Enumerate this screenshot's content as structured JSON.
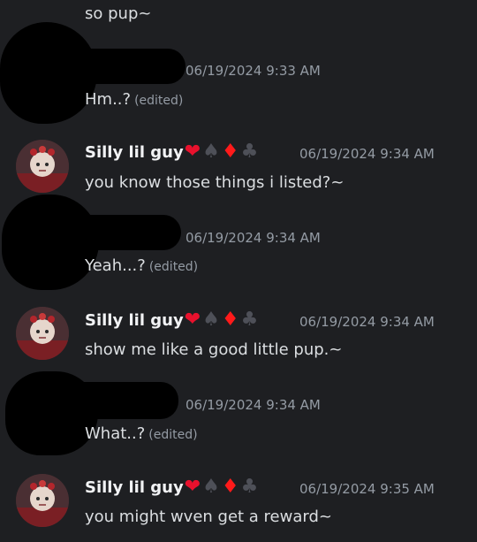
{
  "messages": [
    {
      "kind": "continuation",
      "text": "so pup~"
    },
    {
      "kind": "other",
      "timestamp": "06/19/2024 9:33 AM",
      "text": "Hm..?",
      "edited": "(edited)"
    },
    {
      "kind": "silly",
      "author": "Silly lil guy",
      "timestamp": "06/19/2024 9:34 AM",
      "text": "you know those things i listed?~",
      "suits": [
        "heart",
        "spade",
        "diamond",
        "club"
      ]
    },
    {
      "kind": "other",
      "timestamp": "06/19/2024 9:34 AM",
      "text": "Yeah...?",
      "edited": "(edited)"
    },
    {
      "kind": "silly",
      "author": "Silly lil guy",
      "timestamp": "06/19/2024 9:34 AM",
      "text": "show me like a good little pup.~",
      "suits": [
        "heart",
        "spade",
        "diamond",
        "club"
      ]
    },
    {
      "kind": "other",
      "timestamp": "06/19/2024 9:34 AM",
      "text": "What..?",
      "edited": "(edited)"
    },
    {
      "kind": "silly",
      "author": "Silly lil guy",
      "timestamp": "06/19/2024 9:35 AM",
      "text": "you might wven get a reward~",
      "suits": [
        "heart",
        "spade",
        "diamond",
        "club"
      ]
    }
  ],
  "suit_glyphs": {
    "heart": "❤",
    "spade": "♠",
    "diamond": "♦",
    "club": "♣"
  },
  "colors": {
    "background": "#1e1f22",
    "text": "#dbdee1",
    "muted": "#949ba4",
    "heart": "#e8112d",
    "diamond": "#ff1a1a",
    "spade_club": "#4e5058"
  }
}
